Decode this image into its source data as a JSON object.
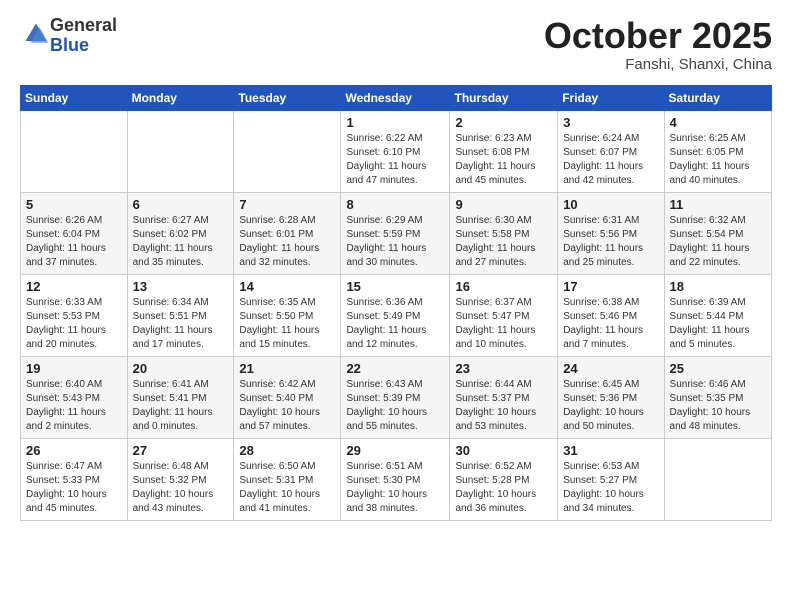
{
  "logo": {
    "general": "General",
    "blue": "Blue"
  },
  "header": {
    "month": "October 2025",
    "location": "Fanshi, Shanxi, China"
  },
  "weekdays": [
    "Sunday",
    "Monday",
    "Tuesday",
    "Wednesday",
    "Thursday",
    "Friday",
    "Saturday"
  ],
  "weeks": [
    [
      {
        "day": "",
        "info": ""
      },
      {
        "day": "",
        "info": ""
      },
      {
        "day": "",
        "info": ""
      },
      {
        "day": "1",
        "info": "Sunrise: 6:22 AM\nSunset: 6:10 PM\nDaylight: 11 hours\nand 47 minutes."
      },
      {
        "day": "2",
        "info": "Sunrise: 6:23 AM\nSunset: 6:08 PM\nDaylight: 11 hours\nand 45 minutes."
      },
      {
        "day": "3",
        "info": "Sunrise: 6:24 AM\nSunset: 6:07 PM\nDaylight: 11 hours\nand 42 minutes."
      },
      {
        "day": "4",
        "info": "Sunrise: 6:25 AM\nSunset: 6:05 PM\nDaylight: 11 hours\nand 40 minutes."
      }
    ],
    [
      {
        "day": "5",
        "info": "Sunrise: 6:26 AM\nSunset: 6:04 PM\nDaylight: 11 hours\nand 37 minutes."
      },
      {
        "day": "6",
        "info": "Sunrise: 6:27 AM\nSunset: 6:02 PM\nDaylight: 11 hours\nand 35 minutes."
      },
      {
        "day": "7",
        "info": "Sunrise: 6:28 AM\nSunset: 6:01 PM\nDaylight: 11 hours\nand 32 minutes."
      },
      {
        "day": "8",
        "info": "Sunrise: 6:29 AM\nSunset: 5:59 PM\nDaylight: 11 hours\nand 30 minutes."
      },
      {
        "day": "9",
        "info": "Sunrise: 6:30 AM\nSunset: 5:58 PM\nDaylight: 11 hours\nand 27 minutes."
      },
      {
        "day": "10",
        "info": "Sunrise: 6:31 AM\nSunset: 5:56 PM\nDaylight: 11 hours\nand 25 minutes."
      },
      {
        "day": "11",
        "info": "Sunrise: 6:32 AM\nSunset: 5:54 PM\nDaylight: 11 hours\nand 22 minutes."
      }
    ],
    [
      {
        "day": "12",
        "info": "Sunrise: 6:33 AM\nSunset: 5:53 PM\nDaylight: 11 hours\nand 20 minutes."
      },
      {
        "day": "13",
        "info": "Sunrise: 6:34 AM\nSunset: 5:51 PM\nDaylight: 11 hours\nand 17 minutes."
      },
      {
        "day": "14",
        "info": "Sunrise: 6:35 AM\nSunset: 5:50 PM\nDaylight: 11 hours\nand 15 minutes."
      },
      {
        "day": "15",
        "info": "Sunrise: 6:36 AM\nSunset: 5:49 PM\nDaylight: 11 hours\nand 12 minutes."
      },
      {
        "day": "16",
        "info": "Sunrise: 6:37 AM\nSunset: 5:47 PM\nDaylight: 11 hours\nand 10 minutes."
      },
      {
        "day": "17",
        "info": "Sunrise: 6:38 AM\nSunset: 5:46 PM\nDaylight: 11 hours\nand 7 minutes."
      },
      {
        "day": "18",
        "info": "Sunrise: 6:39 AM\nSunset: 5:44 PM\nDaylight: 11 hours\nand 5 minutes."
      }
    ],
    [
      {
        "day": "19",
        "info": "Sunrise: 6:40 AM\nSunset: 5:43 PM\nDaylight: 11 hours\nand 2 minutes."
      },
      {
        "day": "20",
        "info": "Sunrise: 6:41 AM\nSunset: 5:41 PM\nDaylight: 11 hours\nand 0 minutes."
      },
      {
        "day": "21",
        "info": "Sunrise: 6:42 AM\nSunset: 5:40 PM\nDaylight: 10 hours\nand 57 minutes."
      },
      {
        "day": "22",
        "info": "Sunrise: 6:43 AM\nSunset: 5:39 PM\nDaylight: 10 hours\nand 55 minutes."
      },
      {
        "day": "23",
        "info": "Sunrise: 6:44 AM\nSunset: 5:37 PM\nDaylight: 10 hours\nand 53 minutes."
      },
      {
        "day": "24",
        "info": "Sunrise: 6:45 AM\nSunset: 5:36 PM\nDaylight: 10 hours\nand 50 minutes."
      },
      {
        "day": "25",
        "info": "Sunrise: 6:46 AM\nSunset: 5:35 PM\nDaylight: 10 hours\nand 48 minutes."
      }
    ],
    [
      {
        "day": "26",
        "info": "Sunrise: 6:47 AM\nSunset: 5:33 PM\nDaylight: 10 hours\nand 45 minutes."
      },
      {
        "day": "27",
        "info": "Sunrise: 6:48 AM\nSunset: 5:32 PM\nDaylight: 10 hours\nand 43 minutes."
      },
      {
        "day": "28",
        "info": "Sunrise: 6:50 AM\nSunset: 5:31 PM\nDaylight: 10 hours\nand 41 minutes."
      },
      {
        "day": "29",
        "info": "Sunrise: 6:51 AM\nSunset: 5:30 PM\nDaylight: 10 hours\nand 38 minutes."
      },
      {
        "day": "30",
        "info": "Sunrise: 6:52 AM\nSunset: 5:28 PM\nDaylight: 10 hours\nand 36 minutes."
      },
      {
        "day": "31",
        "info": "Sunrise: 6:53 AM\nSunset: 5:27 PM\nDaylight: 10 hours\nand 34 minutes."
      },
      {
        "day": "",
        "info": ""
      }
    ]
  ]
}
